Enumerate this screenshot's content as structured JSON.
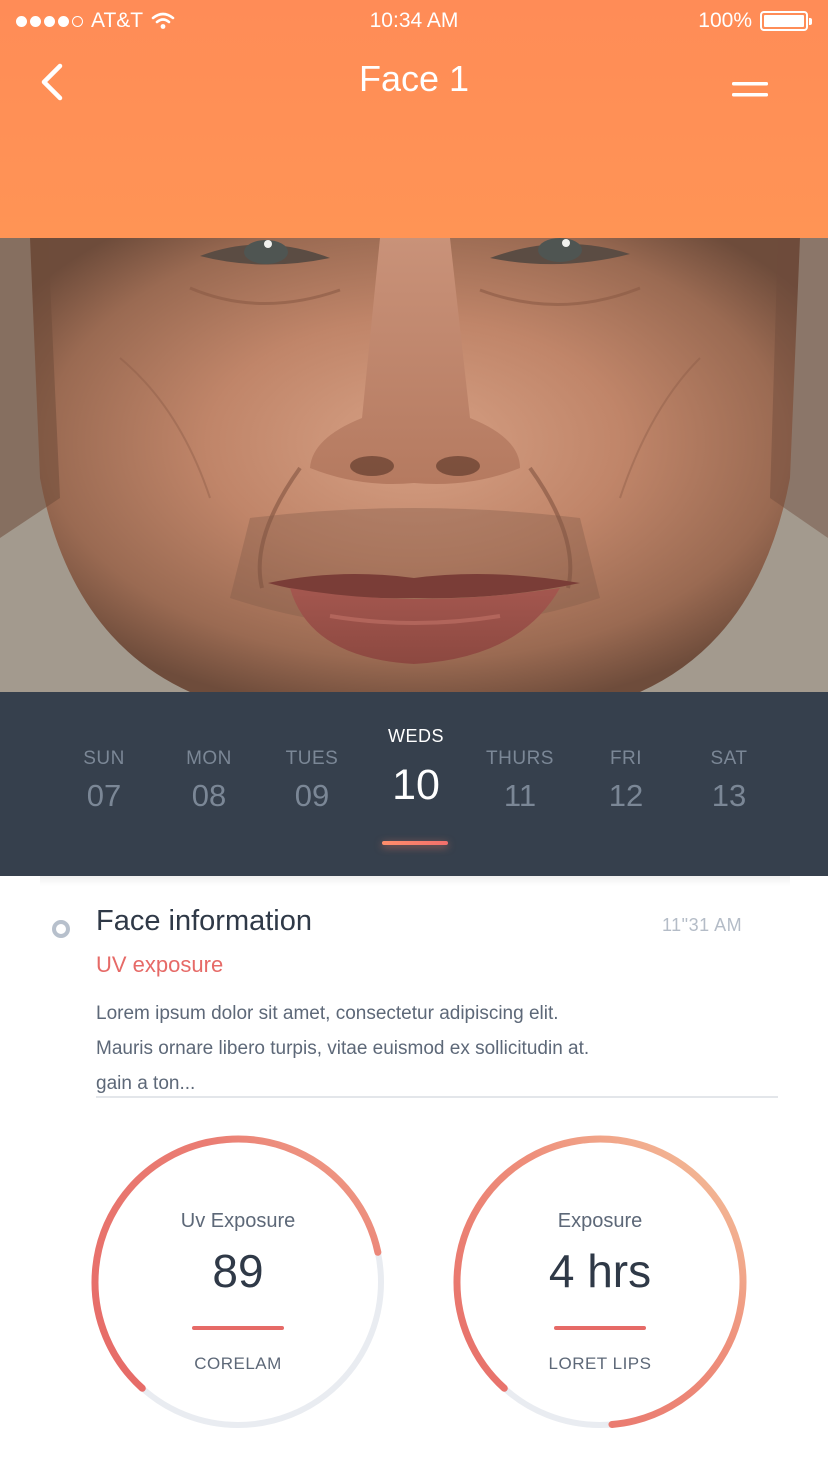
{
  "status_bar": {
    "carrier": "AT&T",
    "time": "10:34 AM",
    "battery": "100%"
  },
  "nav": {
    "title": "Face 1"
  },
  "days": [
    {
      "name": "SUN",
      "num": "07",
      "active": false
    },
    {
      "name": "MON",
      "num": "08",
      "active": false
    },
    {
      "name": "TUES",
      "num": "09",
      "active": false
    },
    {
      "name": "WEDS",
      "num": "10",
      "active": true
    },
    {
      "name": "THURS",
      "num": "11",
      "active": false
    },
    {
      "name": "FRI",
      "num": "12",
      "active": false
    },
    {
      "name": "SAT",
      "num": "13",
      "active": false
    }
  ],
  "info": {
    "title": "Face information",
    "time": "11\"31  AM",
    "subtitle": "UV exposure",
    "body": [
      "Lorem ipsum dolor sit amet, consectetur adipiscing elit.",
      "Mauris ornare libero turpis, vitae euismod ex sollicitudin at.",
      "gain a ton..."
    ]
  },
  "gauges": [
    {
      "label": "Uv Exposure",
      "value": "89",
      "caption": "CORELAM",
      "progress": 0.6
    },
    {
      "label": "Exposure",
      "value": "4 hrs",
      "caption": "LORET LIPS",
      "progress": 0.87
    }
  ],
  "colors": {
    "header": "#ff8c57",
    "days_bg": "#36404d",
    "accent": "#e66a67",
    "accent_light": "#f5c79f",
    "track": "#e9ecf1"
  }
}
